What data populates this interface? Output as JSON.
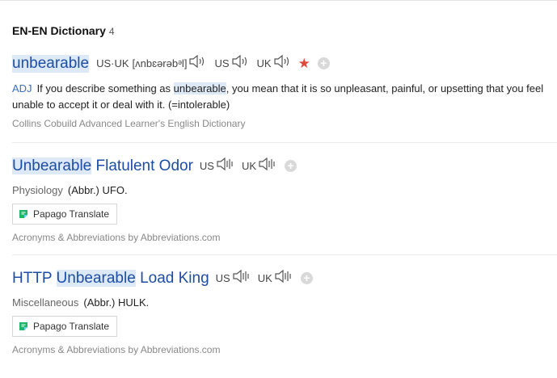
{
  "header": {
    "title": "EN-EN Dictionary",
    "count": "4"
  },
  "entries": [
    {
      "word": "unbearable",
      "us_uk_label": "US·UK",
      "phonetic": "[ʌnbɛərəbᵊl]",
      "us_label": "US",
      "uk_label": "UK",
      "pos": "ADJ",
      "definition_before": "If you describe something as",
      "definition_highlight": "unbearable",
      "definition_after": ", you mean that it is so unpleasant, painful, or upsetting that you feel unable to accept it or deal with it. (=intolerable)",
      "source": "Collins Cobuild Advanced Learner's English Dictionary"
    },
    {
      "word_highlight": "Unbearable",
      "word_rest": " Flatulent Odor",
      "us_label": "US",
      "uk_label": "UK",
      "category": "Physiology",
      "abbr": "(Abbr.) UFO.",
      "translate_label": "Papago Translate",
      "source": "Acronyms & Abbreviations by Abbreviations.com"
    },
    {
      "word_pre": "HTTP ",
      "word_highlight": "Unbearable",
      "word_rest": " Load King",
      "us_label": "US",
      "uk_label": "UK",
      "category": "Miscellaneous",
      "abbr": "(Abbr.) HULK.",
      "translate_label": "Papago Translate",
      "source": "Acronyms & Abbreviations by Abbreviations.com"
    }
  ],
  "icons": {
    "speaker": "speaker-icon",
    "star": "star-icon",
    "add": "add-icon",
    "papago": "papago-icon"
  },
  "colors": {
    "link": "#1d4ea3",
    "highlight": "#dde9f7",
    "star": "#e2493a",
    "pos": "#3a6fbf"
  }
}
